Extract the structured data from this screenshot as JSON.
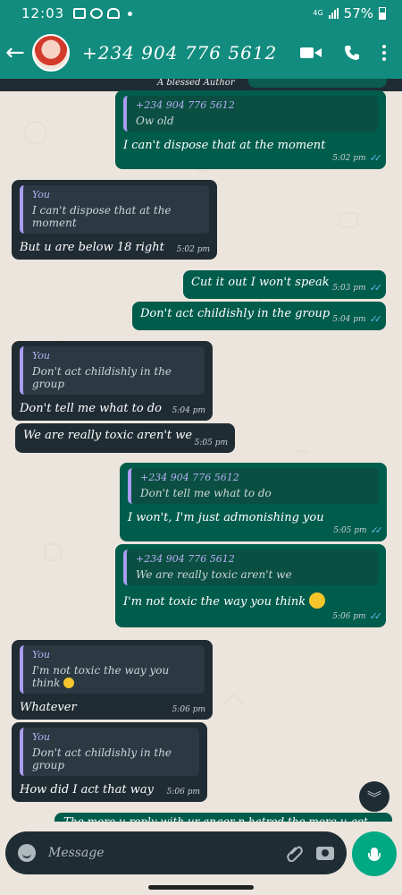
{
  "status": {
    "time": "12:03",
    "network": "4G",
    "battery": "57%"
  },
  "header": {
    "back_label": "←",
    "contact": "+234 904 776 5612"
  },
  "top_strip": {
    "text": "A blessed Author"
  },
  "messages": [
    {
      "quote_name": "+234 904 776 5612",
      "quote_text": "Ow old",
      "text": "I can't dispose that at the moment",
      "time": "5:02 pm"
    },
    {
      "quote_name": "You",
      "quote_text": "I can't dispose that at the moment",
      "text": "But u are below 18 right",
      "time": "5:02 pm"
    },
    {
      "text": "Cut it out I won't speak",
      "time": "5:03 pm"
    },
    {
      "text": "Don't act childishly in the group",
      "time": "5:04 pm"
    },
    {
      "quote_name": "You",
      "quote_text": "Don't act childishly in the group",
      "text": "Don't tell me what to do",
      "time": "5:04 pm"
    },
    {
      "text": "We are really toxic aren't we",
      "time": "5:05 pm"
    },
    {
      "quote_name": "+234 904 776 5612",
      "quote_text": "Don't tell me what to do",
      "text": "I won't, I'm just admonishing you",
      "time": "5:05 pm"
    },
    {
      "quote_name": "+234 904 776 5612",
      "quote_text": "We are really toxic aren't we",
      "text": "I'm not toxic the way you think",
      "time": "5:06 pm"
    },
    {
      "quote_name": "You",
      "quote_text": "I'm not toxic the way you think",
      "text": "Whatever",
      "time": "5:06 pm"
    },
    {
      "quote_name": "You",
      "quote_text": "Don't act childishly in the group",
      "text": "How did I act that way",
      "time": "5:06 pm"
    }
  ],
  "peek_text": "The more u reply with ur anger n hatred the more u get",
  "input": {
    "placeholder": "Message"
  },
  "colors": {
    "header": "#128c7e",
    "outgoing": "#005c4b",
    "incoming": "#202c33",
    "read_ticks": "#53bdeb",
    "mic": "#00a884"
  }
}
